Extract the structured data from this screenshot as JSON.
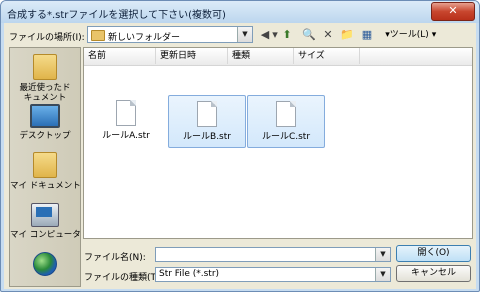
{
  "window": {
    "title": "合成する*.strファイルを選択して下さい(複数可)",
    "close": "✕"
  },
  "look_in": {
    "label": "ファイルの場所(I):",
    "value": "新しいフォルダー",
    "dropdown": "▼"
  },
  "toolbar": {
    "back": "◀",
    "back_arrow": "▾",
    "search": "🔍",
    "delete": "✕",
    "new_folder": "📁",
    "views": "▦",
    "tools_label": "▾ツール(L)",
    "tools_arrow": "▾"
  },
  "places": [
    {
      "label": "最近使ったド\nキュメント",
      "icon": "recent-documents-icon"
    },
    {
      "label": "デスクトップ",
      "icon": "desktop-icon"
    },
    {
      "label": "マイ ドキュメント",
      "icon": "my-documents-icon"
    },
    {
      "label": "マイ コンピュータ",
      "icon": "my-computer-icon"
    },
    {
      "label": "",
      "icon": "network-globe-icon"
    }
  ],
  "columns": [
    "名前",
    "更新日時",
    "種類",
    "サイズ"
  ],
  "files": [
    {
      "name": "ルールA.str",
      "selected": false
    },
    {
      "name": "ルールB.str",
      "selected": true
    },
    {
      "name": "ルールC.str",
      "selected": true
    }
  ],
  "filename": {
    "label": "ファイル名(N):",
    "value": ""
  },
  "filetype": {
    "label": "ファイルの種類(T):",
    "value": "Str File (*.str)"
  },
  "buttons": {
    "open": "開く(O)",
    "cancel": "キャンセル"
  }
}
